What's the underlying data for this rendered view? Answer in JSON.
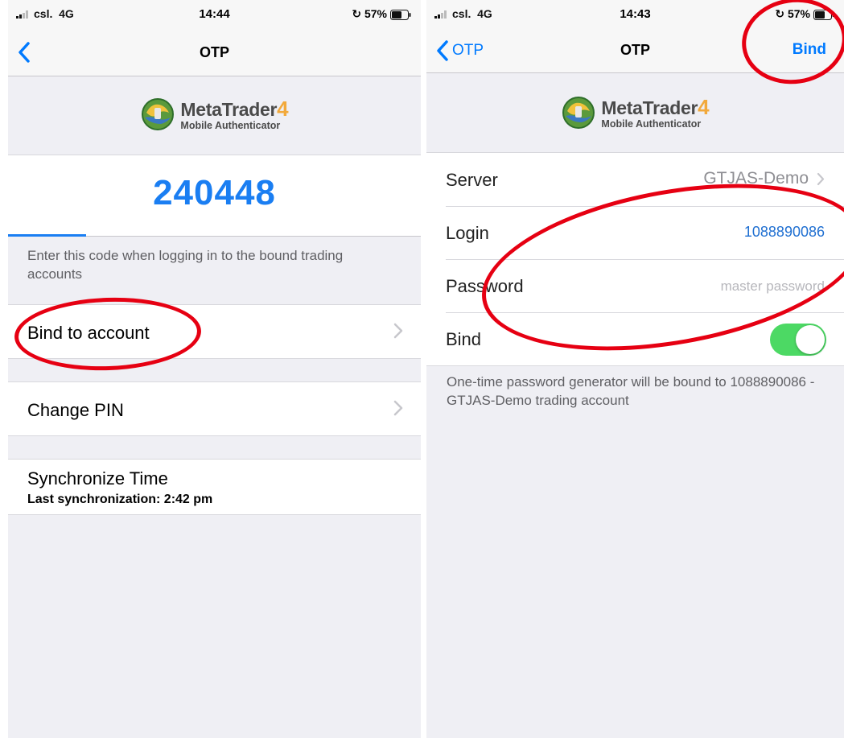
{
  "left": {
    "status": {
      "carrier": "csl.",
      "network": "4G",
      "time": "14:44",
      "battery": "57%"
    },
    "nav": {
      "title": "OTP",
      "back_icon": "chevron-left"
    },
    "logo": {
      "brand": "MetaTrader",
      "brand_num": "4",
      "subtitle": "Mobile Authenticator"
    },
    "otp": {
      "code": "240448",
      "progress": 0.19
    },
    "hint": "Enter this code when logging in to the bound trading accounts",
    "menu": {
      "bind": "Bind to account",
      "change_pin": "Change PIN",
      "sync_title": "Synchronize Time",
      "sync_sub": "Last synchronization: 2:42 pm"
    }
  },
  "right": {
    "status": {
      "carrier": "csl.",
      "network": "4G",
      "time": "14:43",
      "battery": "57%"
    },
    "nav": {
      "title": "OTP",
      "back_label": "OTP",
      "action": "Bind"
    },
    "logo": {
      "brand": "MetaTrader",
      "brand_num": "4",
      "subtitle": "Mobile Authenticator"
    },
    "form": {
      "server_label": "Server",
      "server_value": "GTJAS-Demo",
      "login_label": "Login",
      "login_value": "1088890086",
      "password_label": "Password",
      "password_placeholder": "master password",
      "bind_label": "Bind",
      "bind_on": true
    },
    "note": "One-time password generator will be bound to 1088890086 - GTJAS-Demo trading account"
  },
  "colors": {
    "accent": "#007aff",
    "code": "#1a7ef2",
    "toggle_on": "#4cd964",
    "annotation": "#e60012",
    "logo_num": "#f2a93b"
  }
}
